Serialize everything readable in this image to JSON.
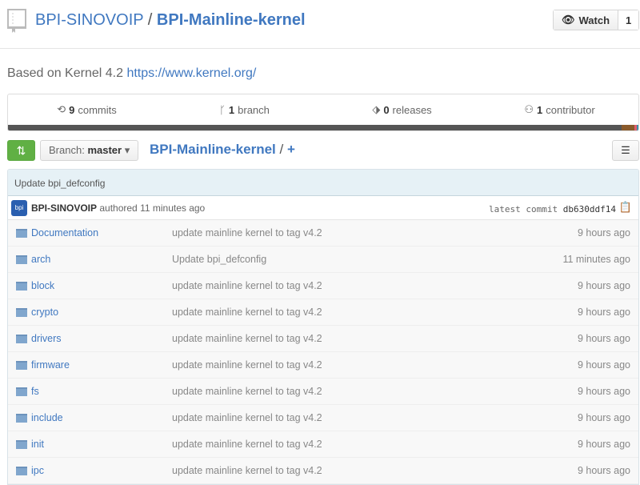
{
  "header": {
    "owner": "BPI-SINOVOIP",
    "separator": "/",
    "repo": "BPI-Mainline-kernel",
    "watch_label": "Watch",
    "watch_count": "1"
  },
  "description": {
    "text": "Based on Kernel 4.2 ",
    "link": "https://www.kernel.org/"
  },
  "stats": [
    {
      "icon": "history-icon",
      "num": "9",
      "label": "commits"
    },
    {
      "icon": "branch-icon",
      "num": "1",
      "label": "branch"
    },
    {
      "icon": "tag-icon",
      "num": "0",
      "label": "releases"
    },
    {
      "icon": "organization-icon",
      "num": "1",
      "label": "contributor"
    }
  ],
  "language_colors": [
    "#555555",
    "#8a5a2b",
    "#e05d6f",
    "#3b8ea5"
  ],
  "toolbar": {
    "branch_prefix": "Branch:",
    "branch": "master",
    "path": "BPI-Mainline-kernel",
    "path_sep": "/",
    "add": "+"
  },
  "commit": {
    "message": "Update bpi_defconfig",
    "author": "BPI-SINOVOIP",
    "authored": "authored 11 minutes ago",
    "latest_label": "latest commit",
    "sha": "db630ddf14",
    "avatar_text": "bpi"
  },
  "files": [
    {
      "name": "Documentation",
      "message": "update mainline kernel to tag v4.2",
      "age": "9 hours ago"
    },
    {
      "name": "arch",
      "message": "Update bpi_defconfig",
      "age": "11 minutes ago"
    },
    {
      "name": "block",
      "message": "update mainline kernel to tag v4.2",
      "age": "9 hours ago"
    },
    {
      "name": "crypto",
      "message": "update mainline kernel to tag v4.2",
      "age": "9 hours ago"
    },
    {
      "name": "drivers",
      "message": "update mainline kernel to tag v4.2",
      "age": "9 hours ago"
    },
    {
      "name": "firmware",
      "message": "update mainline kernel to tag v4.2",
      "age": "9 hours ago"
    },
    {
      "name": "fs",
      "message": "update mainline kernel to tag v4.2",
      "age": "9 hours ago"
    },
    {
      "name": "include",
      "message": "update mainline kernel to tag v4.2",
      "age": "9 hours ago"
    },
    {
      "name": "init",
      "message": "update mainline kernel to tag v4.2",
      "age": "9 hours ago"
    },
    {
      "name": "ipc",
      "message": "update mainline kernel to tag v4.2",
      "age": "9 hours ago"
    }
  ]
}
